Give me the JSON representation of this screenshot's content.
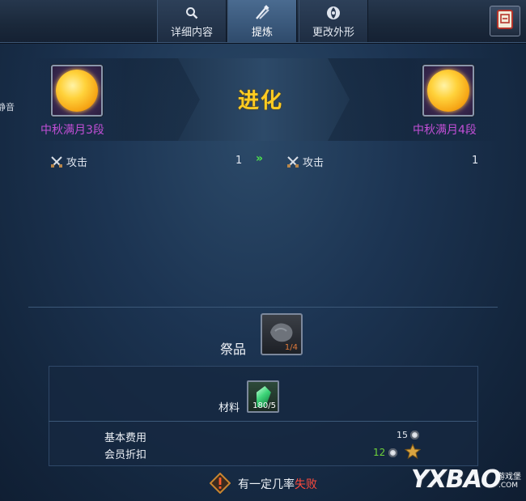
{
  "tabs": [
    {
      "label": "详细内容",
      "icon": "magnifier-icon",
      "active": false
    },
    {
      "label": "提炼",
      "icon": "crossed-tools-icon",
      "active": true
    },
    {
      "label": "更改外形",
      "icon": "appearance-icon",
      "active": false
    }
  ],
  "corner_button": {
    "icon": "card-icon"
  },
  "left_edge_text": "静音",
  "evolve": {
    "label": "进化",
    "source": {
      "name": "中秋满月3段",
      "icon": "full-moon-icon"
    },
    "target": {
      "name": "中秋满月4段",
      "icon": "full-moon-icon"
    }
  },
  "stats": {
    "left": {
      "name": "攻击",
      "value": "1",
      "icon": "crossed-swords-icon"
    },
    "arrow": "»",
    "right": {
      "name": "攻击",
      "value": "1",
      "icon": "crossed-swords-icon"
    }
  },
  "offering": {
    "label": "祭品",
    "count": "1/4"
  },
  "material": {
    "label": "材料",
    "count": "180/5",
    "icon": "green-crystal-icon"
  },
  "costs": {
    "base_label": "基本费用",
    "base_value": "15",
    "member_label": "会员折扣",
    "member_value": "12"
  },
  "warning": {
    "prefix": "有一定几率",
    "highlight": "失败"
  },
  "watermark": {
    "brand": "YXBAO",
    "cn": "游戏堡",
    "domain": ".COM"
  },
  "colors": {
    "item_name": "#c24fd6",
    "evolve_text": "#ffcc22",
    "fail_text": "#ff4a3d",
    "discount_value": "#6fd43a"
  }
}
